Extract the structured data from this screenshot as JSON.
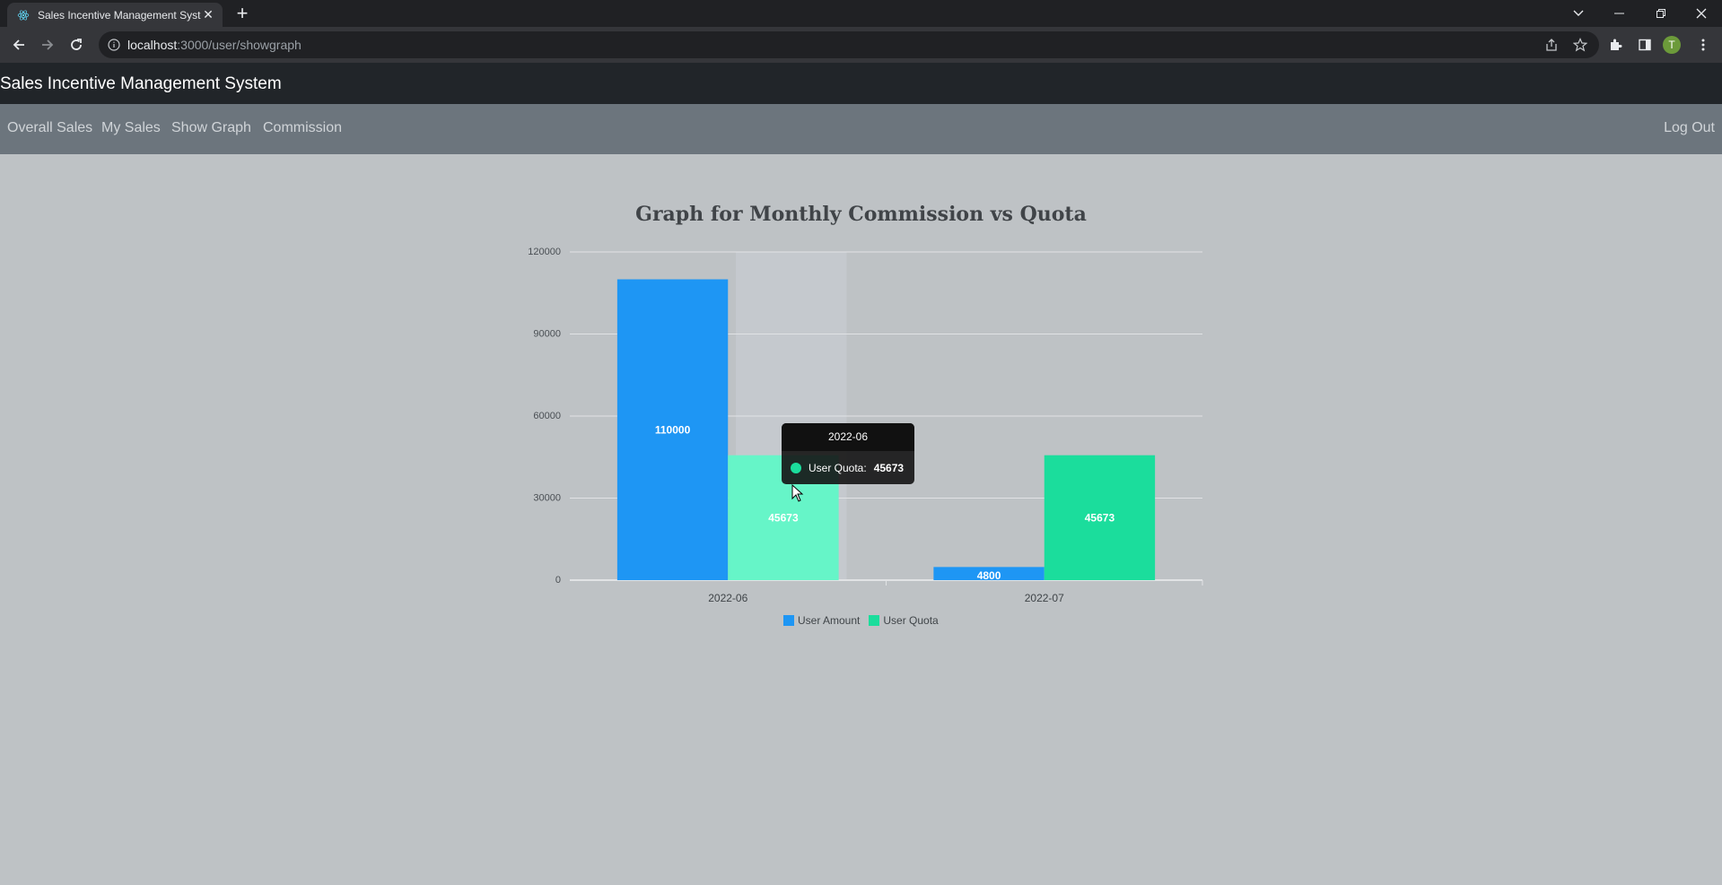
{
  "browser": {
    "tab_title": "Sales Incentive Management System",
    "url_host": "localhost",
    "url_path": ":3000/user/showgraph",
    "profile_initial": "T"
  },
  "app": {
    "brand": "Sales Incentive Management System",
    "nav": [
      "Overall Sales",
      "My Sales",
      "Show Graph",
      "Commission"
    ],
    "logout": "Log Out"
  },
  "colors": {
    "user_amount": "#1e96f4",
    "user_quota": "#1bdd9c",
    "user_quota_hover": "#66f5c8"
  },
  "chart_data": {
    "type": "bar",
    "title": "Graph for Monthly Commission vs Quota",
    "categories": [
      "2022-06",
      "2022-07"
    ],
    "series": [
      {
        "name": "User Amount",
        "values": [
          110000,
          4800
        ]
      },
      {
        "name": "User Quota",
        "values": [
          45673,
          45673
        ]
      }
    ],
    "ylim": [
      0,
      120000
    ],
    "yticks": [
      0,
      30000,
      60000,
      90000,
      120000
    ],
    "grid": true,
    "legend": "bottom",
    "tooltip": {
      "category": "2022-06",
      "series": "User Quota",
      "value": "45673"
    }
  }
}
